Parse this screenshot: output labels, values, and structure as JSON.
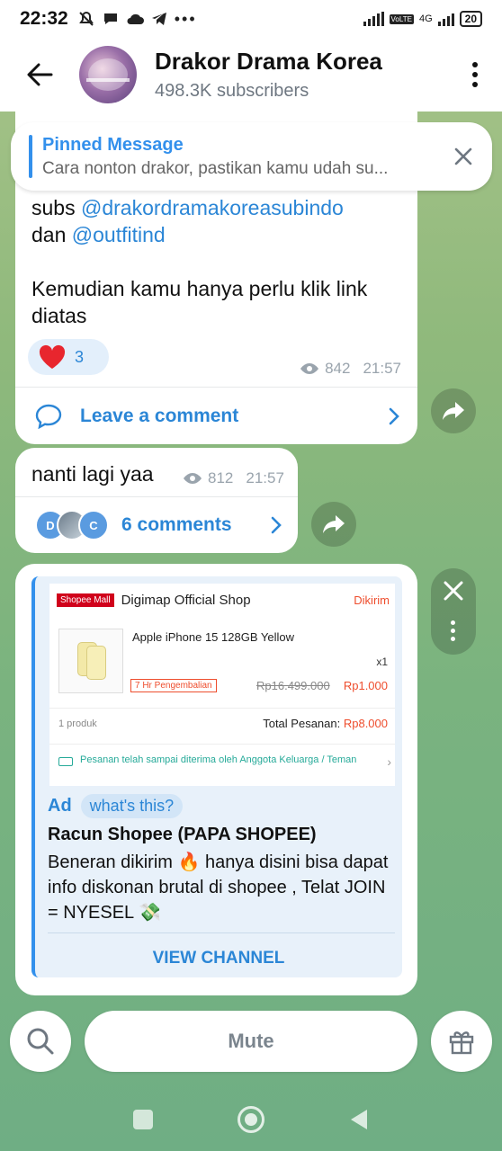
{
  "status_bar": {
    "time": "22:32",
    "network": "4G",
    "lte": "VoLTE",
    "battery": "20"
  },
  "header": {
    "title": "Drakor Drama Korea",
    "subscribers": "498.3K subscribers"
  },
  "pinned": {
    "title": "Pinned Message",
    "text": "Cara nonton drakor, pastikan kamu udah su..."
  },
  "message1": {
    "line1_prefix": "subs ",
    "mention1": "@drakordramakoreasubindo",
    "line2_prefix": "dan ",
    "mention2": "@outfitind",
    "body": "Kemudian kamu hanya perlu klik link diatas",
    "reaction_emoji": "❤️",
    "reaction_count": "3",
    "views": "842",
    "time": "21:57",
    "comment_label": "Leave a comment"
  },
  "message2": {
    "text": "nanti lagi yaa",
    "views": "812",
    "time": "21:57",
    "avatar1": "D",
    "avatar3": "C",
    "comments_label": "6 comments"
  },
  "ad": {
    "screenshot": {
      "mall_badge": "Shopee Mall",
      "shop_name": "Digimap Official Shop",
      "status": "Dikirim",
      "product": "Apple iPhone 15 128GB Yellow",
      "qty": "x1",
      "return_badge": "7 Hr Pengembalian",
      "old_price": "Rp16.499.000",
      "new_price": "Rp1.000",
      "count": "1 produk",
      "total_label": "Total Pesanan: ",
      "total_value": "Rp8.000",
      "delivered": "Pesanan telah sampai diterima oleh Anggota Keluarga / Teman"
    },
    "tag": "Ad",
    "whats_this": "what's this?",
    "title": "Racun Shopee (PAPA SHOPEE)",
    "text": "Beneran dikirim 🔥 hanya disini bisa dapat info diskonan brutal di shopee , Telat JOIN = NYESEL 💸",
    "button": "VIEW CHANNEL"
  },
  "bottom": {
    "mute_label": "Mute"
  },
  "colors": {
    "accent": "#3390ec",
    "link": "#2b86d6",
    "heart": "#e8262e"
  }
}
